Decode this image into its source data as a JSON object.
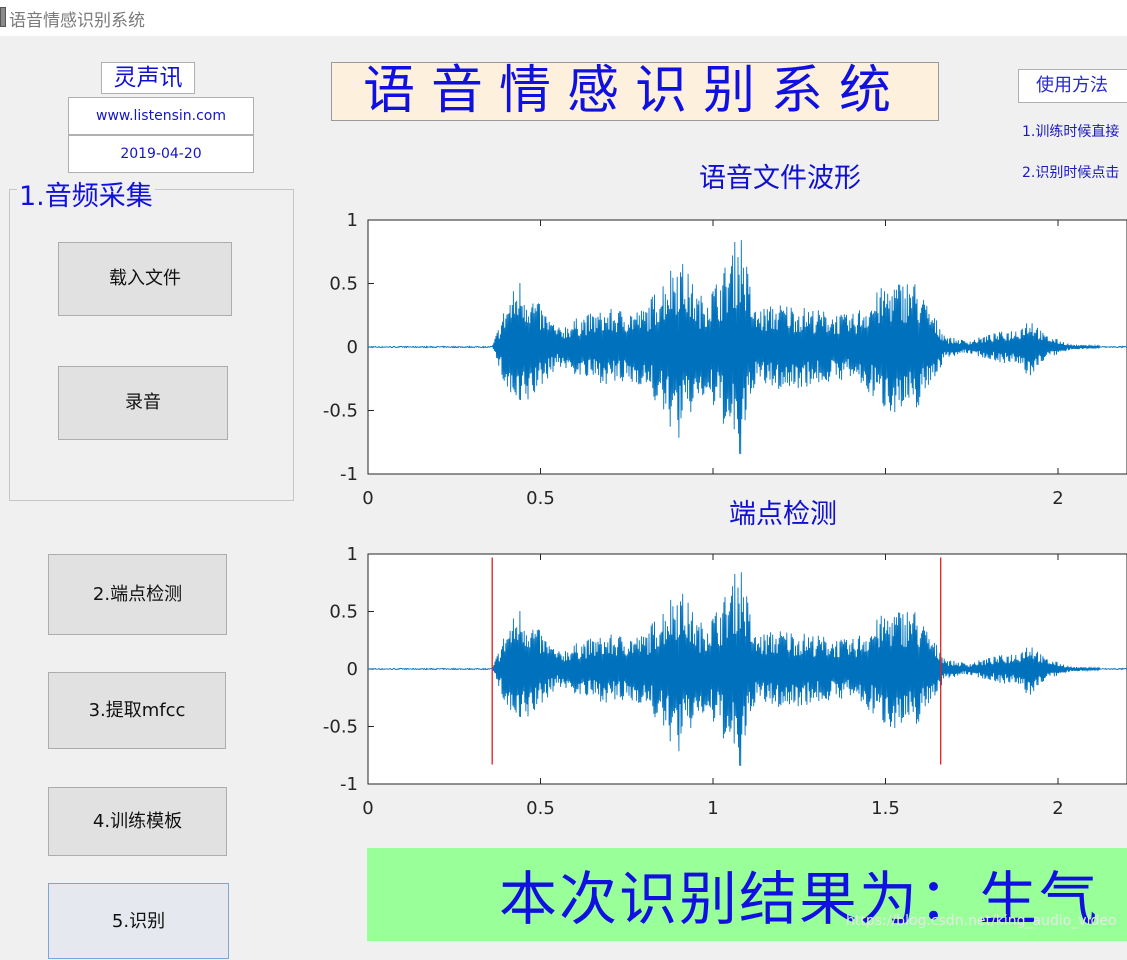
{
  "window": {
    "title": "语音情感识别系统"
  },
  "brand": {
    "name": "灵声讯",
    "website": "www.listensin.com",
    "date": "2019-04-20"
  },
  "header": {
    "title": "语音情感识别系统"
  },
  "usage": {
    "button_label": "使用方法",
    "lines": [
      "1.训练时候直接",
      "2.识别时候点击"
    ]
  },
  "panel1": {
    "title": "1.音频采集",
    "load_button": "载入文件",
    "record_button": "录音"
  },
  "steps": {
    "endpoint_button": "2.端点检测",
    "mfcc_button": "3.提取mfcc",
    "train_button": "4.训练模板",
    "recognize_button": "5.识别"
  },
  "result": {
    "text": "本次识别结果为：生气"
  },
  "watermark": "https://blog.csdn.net/king_audio_video",
  "colors": {
    "waveform": "#0072bd",
    "endpoint": "#e02020",
    "title_blue": "#1010e0",
    "result_bg": "#99ff99"
  },
  "chart_data": [
    {
      "type": "line",
      "title": "语音文件波形",
      "xlim": [
        0,
        2.2
      ],
      "ylim": [
        -1,
        1
      ],
      "yticks": [
        1,
        0.5,
        0,
        -0.5,
        -1
      ],
      "ytick_labels": [
        "1",
        "0.5",
        "0",
        "-0.5",
        "-1"
      ],
      "xticks": [
        0,
        0.5,
        1,
        1.5,
        2
      ],
      "xtick_labels": [
        "0",
        "0.5",
        "",
        "",
        "2"
      ],
      "series": [
        {
          "values": []
        }
      ],
      "envelope_points": [
        [
          0,
          0.0
        ],
        [
          0.36,
          0.0
        ],
        [
          0.4,
          0.35
        ],
        [
          0.44,
          0.55
        ],
        [
          0.48,
          0.4
        ],
        [
          0.55,
          0.15
        ],
        [
          0.62,
          0.25
        ],
        [
          0.7,
          0.3
        ],
        [
          0.8,
          0.3
        ],
        [
          0.9,
          0.75
        ],
        [
          0.96,
          0.4
        ],
        [
          1.02,
          0.55
        ],
        [
          1.08,
          0.95
        ],
        [
          1.12,
          0.3
        ],
        [
          1.2,
          0.35
        ],
        [
          1.3,
          0.3
        ],
        [
          1.4,
          0.25
        ],
        [
          1.5,
          0.5
        ],
        [
          1.58,
          0.55
        ],
        [
          1.64,
          0.25
        ],
        [
          1.68,
          0.08
        ],
        [
          1.74,
          0.05
        ],
        [
          1.8,
          0.1
        ],
        [
          1.88,
          0.15
        ],
        [
          1.92,
          0.25
        ],
        [
          1.96,
          0.1
        ],
        [
          2.04,
          0.02
        ],
        [
          2.2,
          0.0
        ]
      ]
    },
    {
      "type": "line",
      "title": "端点检测",
      "xlim": [
        0,
        2.2
      ],
      "ylim": [
        -1,
        1
      ],
      "yticks": [
        1,
        0.5,
        0,
        -0.5,
        -1
      ],
      "ytick_labels": [
        "1",
        "0.5",
        "0",
        "-0.5",
        "-1"
      ],
      "xticks": [
        0,
        0.5,
        1,
        1.5,
        2
      ],
      "xtick_labels": [
        "0",
        "0.5",
        "1",
        "1.5",
        "2"
      ],
      "endpoints": [
        0.36,
        1.66
      ],
      "series": [
        {
          "values": []
        }
      ]
    }
  ]
}
